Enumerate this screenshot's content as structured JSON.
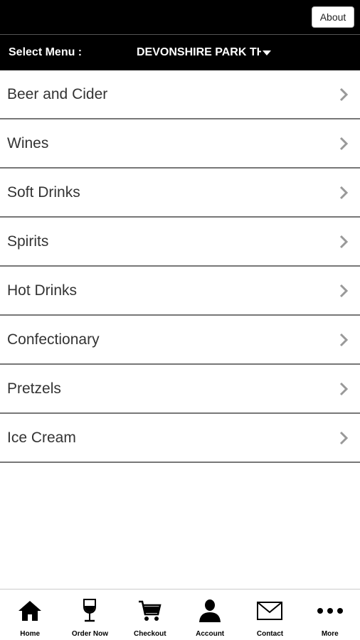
{
  "header": {
    "about_label": "About"
  },
  "menu_bar": {
    "select_label": "Select Menu :",
    "venue_value": "DEVONSHIRE PARK THEATRE"
  },
  "menu_items": [
    {
      "label": "Beer and Cider"
    },
    {
      "label": "Wines"
    },
    {
      "label": "Soft Drinks"
    },
    {
      "label": "Spirits"
    },
    {
      "label": "Hot Drinks"
    },
    {
      "label": "Confectionary"
    },
    {
      "label": "Pretzels"
    },
    {
      "label": "Ice Cream"
    }
  ],
  "tabs": [
    {
      "label": "Home",
      "icon": "home-icon"
    },
    {
      "label": "Order Now",
      "icon": "wine-glass-icon"
    },
    {
      "label": "Checkout",
      "icon": "cart-icon"
    },
    {
      "label": "Account",
      "icon": "person-icon"
    },
    {
      "label": "Contact",
      "icon": "envelope-icon"
    },
    {
      "label": "More",
      "icon": "more-dots-icon"
    }
  ]
}
